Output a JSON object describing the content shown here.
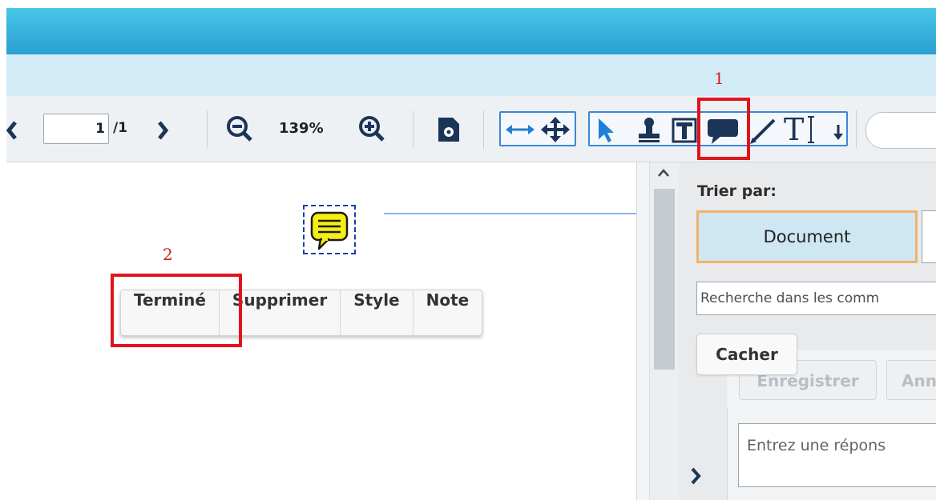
{
  "toolbar": {
    "page_current": "1",
    "page_total": "/1",
    "zoom_level": "139%",
    "prev_page_icon": "chevron-left-icon",
    "next_page_icon": "chevron-right-icon",
    "zoom_out_icon": "zoom-out-icon",
    "zoom_in_icon": "zoom-in-icon",
    "settings_icon": "document-settings-icon",
    "fit_width_icon": "fit-width-icon",
    "pan_icon": "pan-move-icon",
    "select_icon": "pointer-arrow-icon",
    "stamp_icon": "stamp-icon",
    "text_box_icon": "text-box-icon",
    "comment_icon": "speech-bubble-icon",
    "pen_icon": "pen-icon",
    "text_tool_icon": "text-tool-icon",
    "dropdown_icon": "arrow-down-icon"
  },
  "annotations": {
    "callout_1": "1",
    "callout_2": "2"
  },
  "popup": {
    "done": "Terminé",
    "delete": "Supprimer",
    "style": "Style",
    "note": "Note"
  },
  "panel": {
    "sort_label": "Trier par:",
    "sort_document": "Document",
    "search_value": "Recherche dans les comm",
    "hide": "Cacher",
    "save": "Enregistrer",
    "cancel_partial": "Ann",
    "reply_placeholder": "Entrez une répons"
  },
  "colors": {
    "accent_blue": "#3c86d8",
    "callout_red": "#e0141c",
    "note_yellow": "#f6ee11",
    "sort_highlight": "#f2b26a"
  }
}
